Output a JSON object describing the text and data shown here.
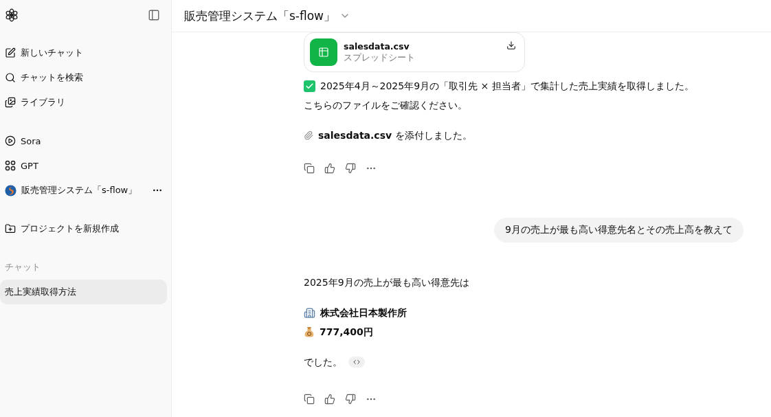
{
  "sidebar": {
    "nav": [
      {
        "kind": "new",
        "label": "新しいチャット"
      },
      {
        "kind": "search",
        "label": "チャットを検索"
      },
      {
        "kind": "library",
        "label": "ライブラリ"
      }
    ],
    "apps": [
      {
        "kind": "sora",
        "label": "Sora"
      },
      {
        "kind": "gpt",
        "label": "GPT"
      },
      {
        "kind": "custom",
        "label": "販売管理システム「s-flow」"
      }
    ],
    "project": {
      "label": "プロジェクトを新規作成"
    },
    "section_label": "チャット",
    "chats": [
      {
        "label": "売上実績取得方法",
        "selected": true
      }
    ]
  },
  "header": {
    "title": "販売管理システム「s-flow」"
  },
  "messages": [
    {
      "kind": "assistant",
      "blocks": [
        {
          "kind": "file",
          "name": "salesdata.csv",
          "type": "スプレッドシート"
        },
        {
          "kind": "done",
          "text": "2025年4月～2025年9月の「取引先 × 担当者」で集計した売上実績を取得しました。"
        },
        {
          "kind": "text",
          "text": "こちらのファイルをご確認ください。"
        },
        {
          "kind": "attachment",
          "text": "**salesdata.csv** を添付しました。"
        }
      ]
    },
    {
      "kind": "user",
      "text": "9月の売上が最も高い得意先名とその売上高を教えて"
    },
    {
      "kind": "assistant",
      "blocks": [
        {
          "kind": "text",
          "text": "2025年9月の売上が最も高い得意先は"
        },
        {
          "kind": "company",
          "text": "株式会社日本製作所"
        },
        {
          "kind": "amount",
          "text": "777,400円"
        },
        {
          "kind": "closing",
          "text": "でした。"
        }
      ]
    }
  ]
}
